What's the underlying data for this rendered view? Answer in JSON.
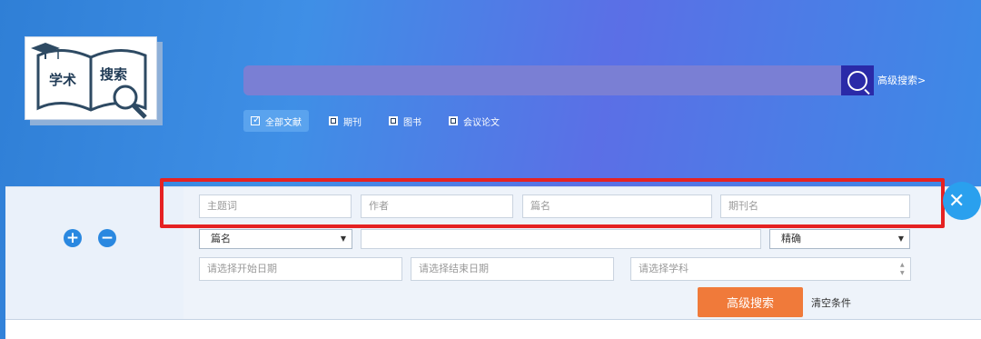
{
  "logo": {
    "text_left": "学术",
    "text_right": "搜索"
  },
  "search": {
    "placeholder": "",
    "advanced_link": "高级搜索>"
  },
  "filters": [
    {
      "label": "全部文献",
      "checked": true
    },
    {
      "label": "期刊",
      "checked": false
    },
    {
      "label": "图书",
      "checked": false
    },
    {
      "label": "会议论文",
      "checked": false
    }
  ],
  "advanced": {
    "row1": [
      "主题词",
      "作者",
      "篇名",
      "期刊名"
    ],
    "field_select": "篇名",
    "match_select": "精确",
    "start_date": "请选择开始日期",
    "end_date": "请选择结束日期",
    "subject": "请选择学科",
    "submit_label": "高级搜索",
    "clear_label": "清空条件",
    "add_symbol": "+",
    "remove_symbol": "−",
    "close_symbol": "✕"
  },
  "colors": {
    "accent": "#2a88e0",
    "submit": "#f07a3a",
    "highlight": "#e52222"
  }
}
